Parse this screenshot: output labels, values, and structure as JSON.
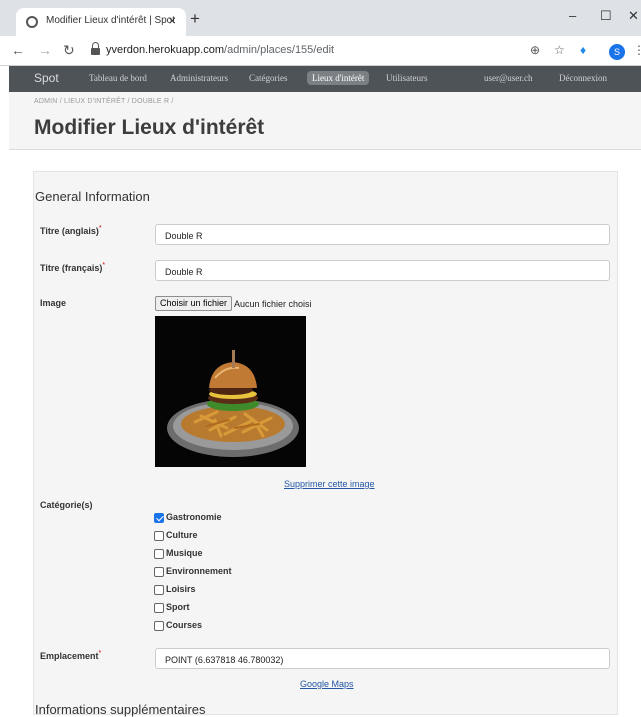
{
  "browser": {
    "tab_title": "Modifier Lieux d'intérêt | Spot",
    "tab_close": "×",
    "new_tab": "+",
    "url_host": "yverdon.herokuapp.com",
    "url_path": "/admin/places/155/edit",
    "avatar_letter": "S",
    "icons": [
      "globe-icon",
      "back-arrow-icon",
      "forward-arrow-icon",
      "reload-icon",
      "lock-icon",
      "zoom-icon",
      "star-icon",
      "extension-icon",
      "menu-icon"
    ]
  },
  "navbar": {
    "brand": "Spot",
    "items": [
      "Tableau de bord",
      "Administrateurs",
      "Catégories",
      "Lieux d'intérêt",
      "Utilisateurs"
    ],
    "active": "Lieux d'intérêt",
    "user": "user@user.ch",
    "logout": "Déconnexion"
  },
  "header": {
    "breadcrumb": "ADMIN / LIEUX D'INTÉRÊT / DOUBLE R /",
    "title": "Modifier Lieux d'intérêt"
  },
  "form": {
    "section_general": "General Information",
    "title_en_label": "Titre (anglais)",
    "title_en_value": "Double R",
    "title_fr_label": "Titre (français)",
    "title_fr_value": "Double R",
    "required_mark": "*",
    "image_label": "Image",
    "file_button": "Choisir un fichier",
    "file_status": "Aucun fichier choisi",
    "remove_image": "Supprimer cette image",
    "categories_label": "Catégorie(s)",
    "categories": [
      {
        "label": "Gastronomie",
        "checked": true
      },
      {
        "label": "Culture",
        "checked": false
      },
      {
        "label": "Musique",
        "checked": false
      },
      {
        "label": "Environnement",
        "checked": false
      },
      {
        "label": "Loisirs",
        "checked": false
      },
      {
        "label": "Sport",
        "checked": false
      },
      {
        "label": "Courses",
        "checked": false
      }
    ],
    "location_label": "Emplacement",
    "location_value": "POINT (6.637818 46.780032)",
    "maps_link": "Google Maps",
    "section_extra": "Informations supplémentaires"
  },
  "colors": {
    "navbar_bg": "#4e5358",
    "link": "#2456a4",
    "checkbox_on": "#1a73e8"
  }
}
